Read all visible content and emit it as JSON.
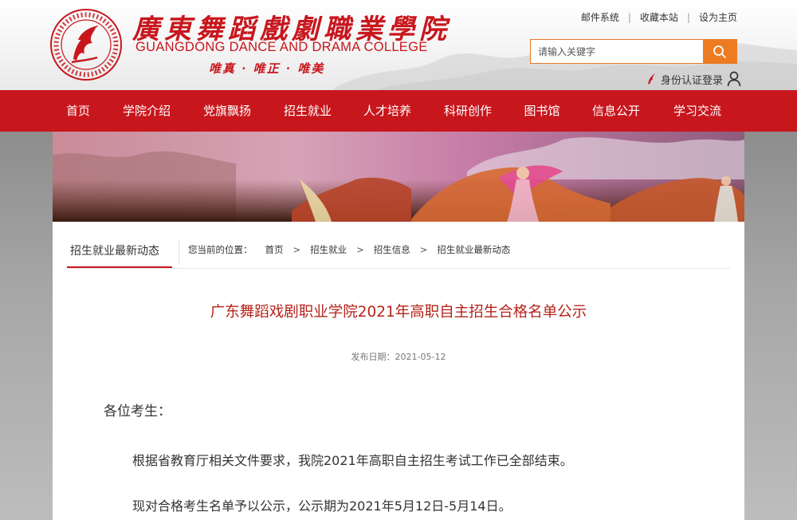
{
  "header": {
    "logo_cn": "廣東舞蹈戲劇職業學院",
    "logo_en": "GUANGDONG DANCE AND DRAMA COLLEGE",
    "motto": "唯真 · 唯正 · 唯美",
    "emblem_ring_text": "GUANGDONG DANCE AND DRAMA COLLEGE",
    "toplinks": [
      "邮件系统",
      "收藏本站",
      "设为主页"
    ],
    "search_placeholder": "请输入关键字",
    "login_label": "身份认证登录"
  },
  "nav": {
    "items": [
      "首页",
      "学院介绍",
      "党旗飘扬",
      "招生就业",
      "人才培养",
      "科研创作",
      "图书馆",
      "信息公开",
      "学习交流"
    ]
  },
  "sidebar": {
    "title": "招生就业最新动态"
  },
  "breadcrumb": {
    "label": "您当前的位置：",
    "items": [
      "首页",
      "招生就业",
      "招生信息",
      "招生就业最新动态"
    ]
  },
  "article": {
    "title": "广东舞蹈戏剧职业学院2021年高职自主招生合格名单公示",
    "date": "发布日期：2021-05-12",
    "greeting": "各位考生：",
    "paragraphs": [
      "根据省教育厅相关文件要求，我院2021年高职自主招生考试工作已全部结束。",
      "现对合格考生名单予以公示，公示期为2021年5月12日-5月14日。"
    ]
  },
  "colors": {
    "brand_red": "#c8161d",
    "search_orange": "#ed7b22",
    "title_red": "#b5231a"
  },
  "icons": [
    "college-emblem-icon",
    "search-icon",
    "person-icon",
    "feather-icon"
  ]
}
